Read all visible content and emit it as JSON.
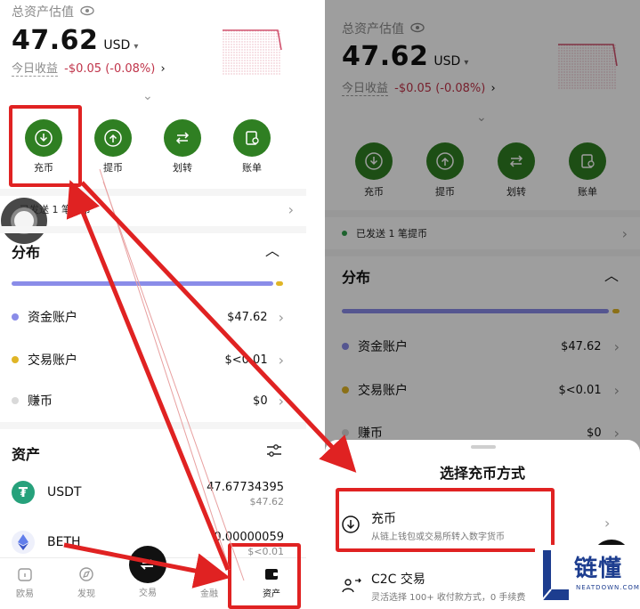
{
  "screen": {
    "total_label": "总资产估值",
    "total_value": "47.62",
    "currency": "USD",
    "pnl_label": "今日收益",
    "pnl_value": "-$0.05 (-0.08%)",
    "actions": [
      {
        "label": "充币",
        "icon": "download-icon"
      },
      {
        "label": "提币",
        "icon": "upload-icon"
      },
      {
        "label": "划转",
        "icon": "transfer-icon"
      },
      {
        "label": "账单",
        "icon": "bill-icon"
      }
    ],
    "notice": "已发送 1 笔提币",
    "distribution_title": "分布",
    "accounts": [
      {
        "name": "资金账户",
        "value": "$47.62",
        "color": "#8a8ce8"
      },
      {
        "name": "交易账户",
        "value": "$<0.01",
        "color": "#e0b526"
      },
      {
        "name": "赚币",
        "value": "$0",
        "color": "#d9d9d9"
      }
    ],
    "assets_title": "资产",
    "assets": [
      {
        "symbol": "USDT",
        "amount": "47.67734395",
        "usd": "$47.62"
      },
      {
        "symbol": "BETH",
        "amount": "0.00000059",
        "usd": "$<0.01"
      }
    ],
    "nav": [
      {
        "label": "欧易",
        "icon": "home-icon"
      },
      {
        "label": "发现",
        "icon": "discover-icon"
      },
      {
        "label": "交易",
        "icon": "trade-icon"
      },
      {
        "label": "金融",
        "icon": "finance-icon"
      },
      {
        "label": "资产",
        "icon": "wallet-icon"
      }
    ]
  },
  "sheet": {
    "title": "选择充币方式",
    "options": [
      {
        "title": "充币",
        "desc": "从链上钱包或交易所转入数字货币"
      },
      {
        "title": "C2C 交易",
        "desc": "灵活选择 100+ 收付款方式，0 手续费"
      }
    ]
  },
  "watermark": {
    "text": "链懂",
    "sub": "NEATDOWN.COM"
  },
  "colors": {
    "accent": "#2f7f22",
    "negative": "#c0344a",
    "highlight": "#e02222"
  }
}
